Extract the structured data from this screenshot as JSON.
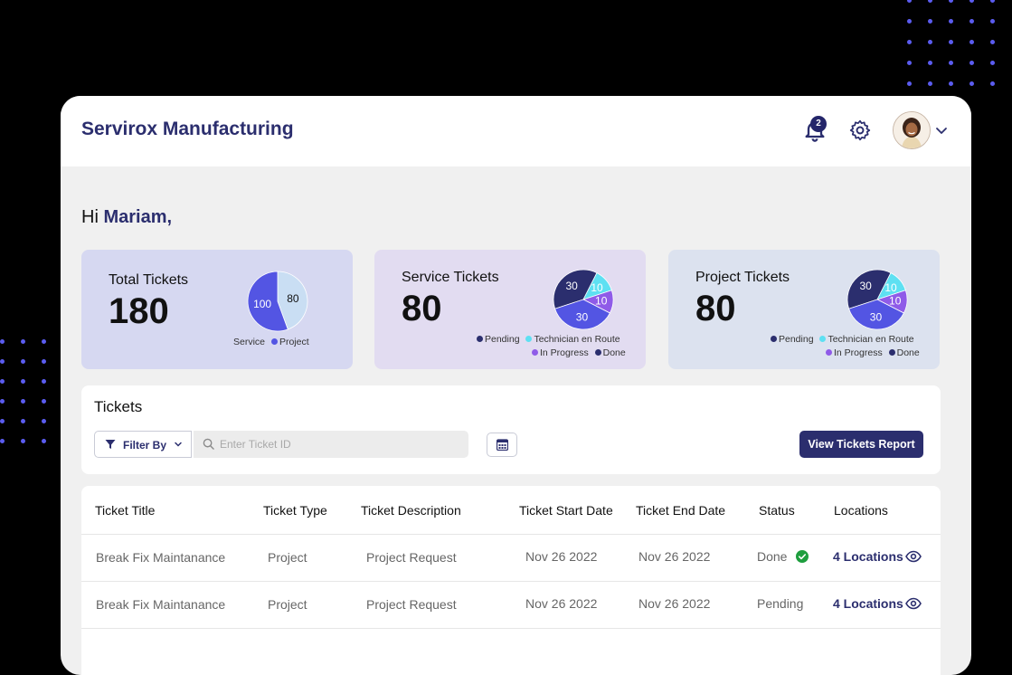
{
  "app": {
    "title": "Servirox Manufacturing",
    "notification_count": "2"
  },
  "greeting": {
    "prefix": "Hi",
    "name": "Mariam,"
  },
  "cards": {
    "total": {
      "title": "Total Tickets",
      "value": "180",
      "legend": [
        "Service",
        "Project"
      ],
      "chart_data": {
        "type": "pie",
        "categories": [
          "Service",
          "Project"
        ],
        "values": [
          80,
          100
        ],
        "colors": [
          "#c9def3",
          "#5355e3"
        ]
      }
    },
    "service": {
      "title": "Service Tickets",
      "value": "80",
      "legend": [
        "Pending",
        "Technician en Route",
        "In Progress",
        "Done"
      ],
      "chart_data": {
        "type": "pie",
        "categories": [
          "Pending",
          "Technician en Route",
          "In Progress",
          "Done"
        ],
        "values": [
          30,
          10,
          10,
          30
        ],
        "colors": [
          "#2b2e6e",
          "#5ee0f2",
          "#8f5be8",
          "#5355e3"
        ]
      }
    },
    "project": {
      "title": "Project Tickets",
      "value": "80",
      "legend": [
        "Pending",
        "Technician en Route",
        "In Progress",
        "Done"
      ],
      "chart_data": {
        "type": "pie",
        "categories": [
          "Pending",
          "Technician en Route",
          "In Progress",
          "Done"
        ],
        "values": [
          30,
          10,
          10,
          30
        ],
        "colors": [
          "#2b2e6e",
          "#5ee0f2",
          "#8f5be8",
          "#5355e3"
        ]
      }
    }
  },
  "tickets": {
    "title": "Tickets",
    "filter_label": "Filter By",
    "search_placeholder": "Enter Ticket ID",
    "report_button": "View Tickets Report",
    "columns": [
      "Ticket Title",
      "Ticket Type",
      "Ticket Description",
      "Ticket Start Date",
      "Ticket End Date",
      "Status",
      "Locations"
    ],
    "rows": [
      {
        "title": "Break Fix Maintanance",
        "type": "Project",
        "description": "Project Request",
        "start": "Nov 26 2022",
        "end": "Nov 26 2022",
        "status": "Done",
        "locations": "4 Locations"
      },
      {
        "title": "Break Fix Maintanance",
        "type": "Project",
        "description": "Project Request",
        "start": "Nov 26 2022",
        "end": "Nov 26 2022",
        "status": "Pending",
        "locations": "4 Locations"
      }
    ]
  },
  "colors": {
    "brand": "#2b2e6e",
    "accent": "#5355e3",
    "done_check": "#1e9e3e"
  },
  "icons": [
    "bell-icon",
    "gear-icon",
    "chevron-down-icon",
    "funnel-icon",
    "search-icon",
    "calendar-icon",
    "check-circle-icon",
    "eye-icon"
  ]
}
